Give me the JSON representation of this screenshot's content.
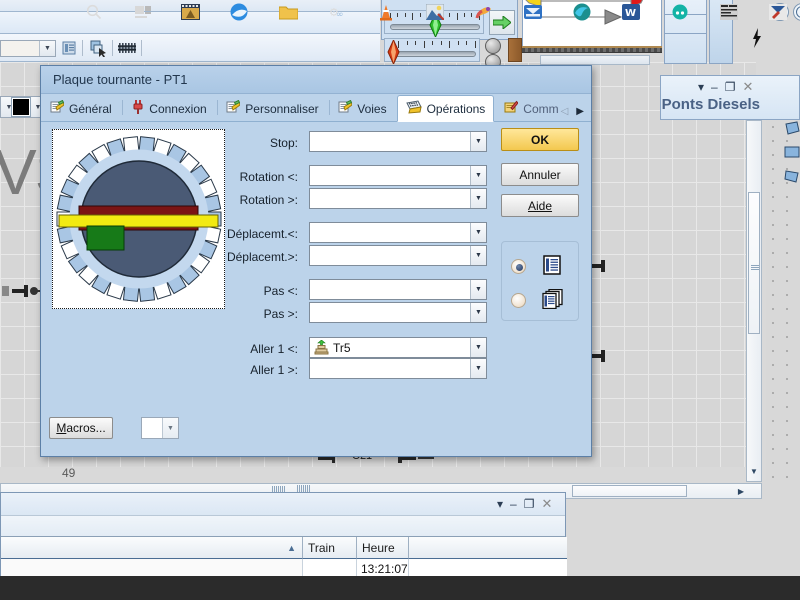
{
  "dialog": {
    "title": "Plaque tournante - PT1",
    "tabs": [
      {
        "label": "Général",
        "icon": "properties-icon",
        "active": false
      },
      {
        "label": "Connexion",
        "icon": "plug-icon",
        "active": false
      },
      {
        "label": "Personnaliser",
        "icon": "properties-icon",
        "active": false
      },
      {
        "label": "Voies",
        "icon": "properties-icon",
        "active": false
      },
      {
        "label": "Opérations",
        "icon": "keyboard-icon",
        "active": true
      },
      {
        "label": "Commenta",
        "icon": "note-edit-icon",
        "active": false
      }
    ],
    "tab_scroll_left": "◁",
    "tab_scroll_right": "▶",
    "fields": [
      {
        "label": "Stop:",
        "value": "",
        "icon": ""
      },
      {
        "label": "Rotation <:",
        "value": "",
        "icon": ""
      },
      {
        "label": "Rotation >:",
        "value": "",
        "icon": ""
      },
      {
        "label": "Déplacemt.<:",
        "value": "",
        "icon": ""
      },
      {
        "label": "Déplacemt.>:",
        "value": "",
        "icon": ""
      },
      {
        "label": "Pas <:",
        "value": "",
        "icon": ""
      },
      {
        "label": "Pas >:",
        "value": "",
        "icon": ""
      },
      {
        "label": "Aller 1 <:",
        "value": "Tr5",
        "icon": "turntable-icon"
      },
      {
        "label": "Aller 1 >:",
        "value": "",
        "icon": ""
      }
    ],
    "buttons": {
      "ok": "OK",
      "cancel": "Annuler",
      "help": "Aide",
      "macros": "Macros..."
    },
    "view_options": [
      {
        "name": "single-list-view",
        "icon": "list-document-icon",
        "selected": true
      },
      {
        "name": "stacked-list-view",
        "icon": "stacked-documents-icon",
        "selected": false
      }
    ],
    "macro_combo_value": "",
    "preview": {
      "name": "turntable-preview",
      "colors": {
        "disc": "#4a5a75",
        "bridge": "#7b1414",
        "beam": "#f2ea12",
        "car": "#177a18",
        "stub_fill": "#a9c6e4",
        "stub_empty": "#ffffff"
      }
    }
  },
  "right_window": {
    "title": "Ponts Diesels",
    "buttons": {
      "menu": "▾",
      "minimize": "–",
      "maximize": "❐",
      "close": "✕"
    }
  },
  "log_window": {
    "buttons": {
      "menu": "▾",
      "minimize": "–",
      "maximize": "❐",
      "close": "✕"
    },
    "columns": [
      "",
      "Train",
      "Heure"
    ],
    "sort_indicator": "▲",
    "rows": [
      {
        "first": "",
        "train": "",
        "heure": "13:21:07"
      }
    ]
  },
  "canvas": {
    "logo_text": "VS",
    "element_number": "49",
    "label_c21": "C21"
  },
  "toolbar": {
    "combo_value": "",
    "icons": [
      "panel-icon",
      "select-arrow-icon",
      "track-icon"
    ]
  },
  "taskbar": {
    "items": [
      "search-icon",
      "task-view-icon",
      "media-icon",
      "browser-icon",
      "folder-icon",
      "settings-icon",
      "cone-icon",
      "photo-icon",
      "paint-icon",
      "mail-icon",
      "edge-icon",
      "word-icon",
      "teal-icon",
      "layout-icon",
      "editor-icon"
    ]
  },
  "colors": {
    "accent": "#f3c84f",
    "dialog_bg": "#bcd3ea",
    "title_text": "#4a6285"
  }
}
